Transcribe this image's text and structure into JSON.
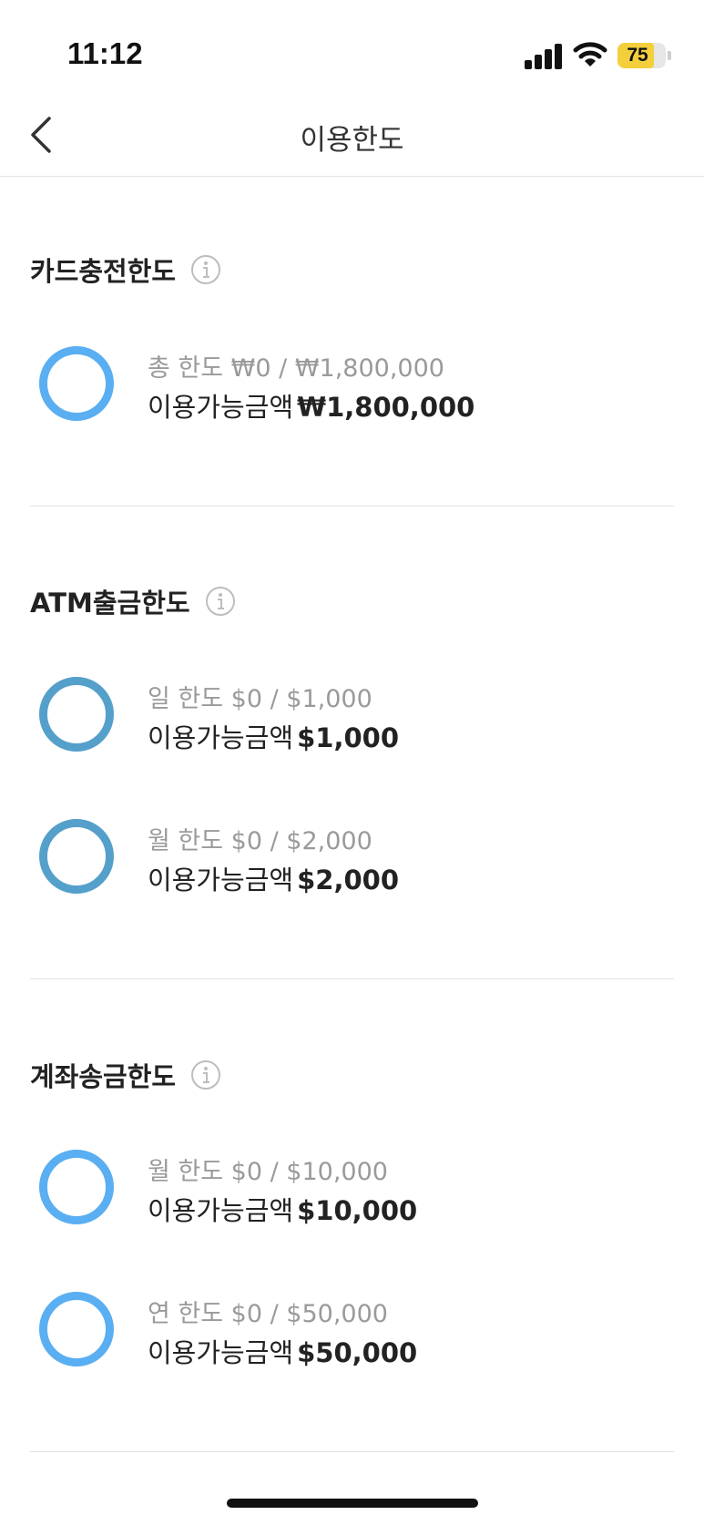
{
  "status_bar": {
    "time": "11:12",
    "battery": "75",
    "battery_level": 0.75
  },
  "header": {
    "title": "이용한도",
    "back_icon": "chevron-left-icon"
  },
  "available_label": "이용가능금액",
  "sections": [
    {
      "title": "카드충전한도",
      "info_icon": "info-icon",
      "items": [
        {
          "limit_text": "총 한도 ₩0 / ₩1,800,000",
          "available_amount": "₩1,800,000",
          "ring_color": "#5aaef2"
        }
      ]
    },
    {
      "title": "ATM출금한도",
      "info_icon": "info-icon",
      "items": [
        {
          "limit_text": "일 한도 $0 / $1,000",
          "available_amount": "$1,000",
          "ring_color": "#55a0cb"
        },
        {
          "limit_text": "월 한도 $0 / $2,000",
          "available_amount": "$2,000",
          "ring_color": "#55a0cb"
        }
      ]
    },
    {
      "title": "계좌송금한도",
      "info_icon": "info-icon",
      "items": [
        {
          "limit_text": "월 한도 $0 / $10,000",
          "available_amount": "$10,000",
          "ring_color": "#5aaef2"
        },
        {
          "limit_text": "연 한도 $0 / $50,000",
          "available_amount": "$50,000",
          "ring_color": "#5aaef2"
        }
      ]
    }
  ]
}
